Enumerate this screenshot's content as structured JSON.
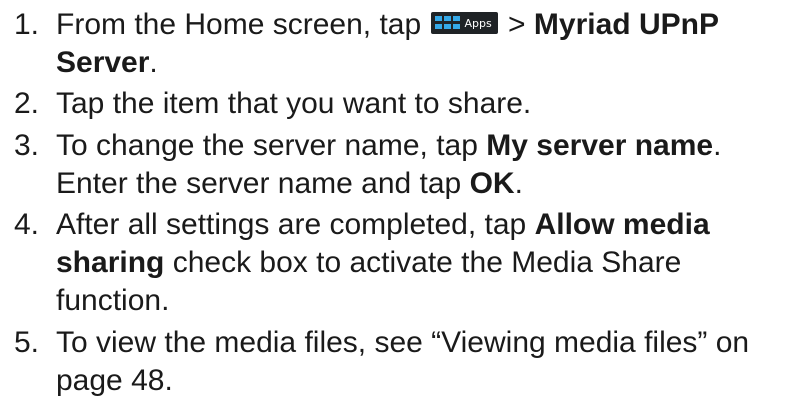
{
  "steps": [
    {
      "number": "1.",
      "lines": [
        [
          {
            "text": "From the Home screen, tap ",
            "bold": false
          },
          {
            "icon": "apps-icon",
            "label": "Apps"
          },
          {
            "text": " > ",
            "bold": false
          },
          {
            "text": "Myriad UPnP",
            "bold": true
          }
        ],
        [
          {
            "text": "Server",
            "bold": true
          },
          {
            "text": ".",
            "bold": false
          }
        ]
      ]
    },
    {
      "number": "2.",
      "lines": [
        [
          {
            "text": "Tap the item that you want to share.",
            "bold": false
          }
        ]
      ]
    },
    {
      "number": "3.",
      "lines": [
        [
          {
            "text": "To change the server name, tap ",
            "bold": false
          },
          {
            "text": "My server name",
            "bold": true
          },
          {
            "text": ".",
            "bold": false
          }
        ],
        [
          {
            "text": "Enter the server name and tap ",
            "bold": false
          },
          {
            "text": "OK",
            "bold": true
          },
          {
            "text": ".",
            "bold": false
          }
        ]
      ]
    },
    {
      "number": "4.",
      "lines": [
        [
          {
            "text": "After all settings are completed, tap ",
            "bold": false
          },
          {
            "text": "Allow media",
            "bold": true
          }
        ],
        [
          {
            "text": "sharing",
            "bold": true
          },
          {
            "text": " check box to activate the Media Share",
            "bold": false
          }
        ],
        [
          {
            "text": "function.",
            "bold": false
          }
        ]
      ]
    },
    {
      "number": "5.",
      "lines": [
        [
          {
            "text": "To view the media files,",
            "bold": false
          },
          {
            "text": " see “Viewing media files” on",
            "bold": false
          }
        ],
        [
          {
            "text": "page 48.",
            "bold": false
          }
        ]
      ]
    }
  ],
  "colors": {
    "text": "#1a1a1a",
    "apps_badge_bg": "#1f2326",
    "apps_grid": "#35a9e8",
    "apps_label": "#ffffff"
  }
}
